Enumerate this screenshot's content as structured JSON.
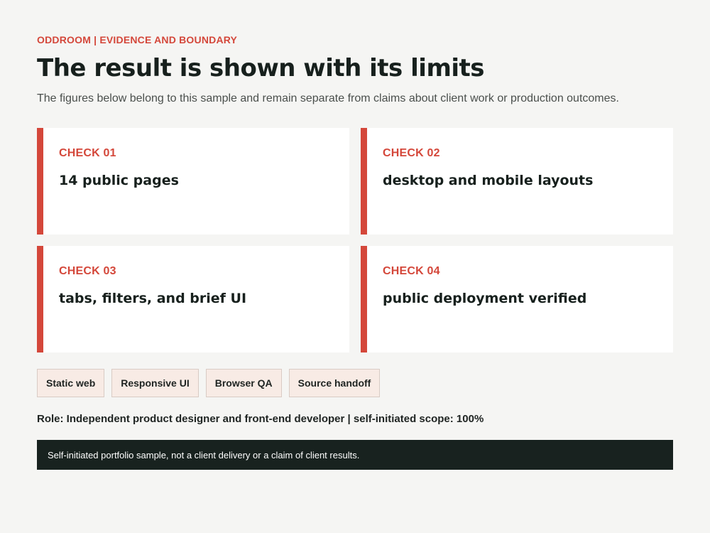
{
  "header": {
    "eyebrow": "ODDROOM | EVIDENCE AND BOUNDARY",
    "title": "The result is shown with its limits",
    "subtitle": "The figures below belong to this sample and remain separate from claims about client work or production outcomes."
  },
  "checks": [
    {
      "label": "CHECK 01",
      "text": "14 public pages"
    },
    {
      "label": "CHECK 02",
      "text": "desktop and mobile layouts"
    },
    {
      "label": "CHECK 03",
      "text": "tabs, filters, and brief UI"
    },
    {
      "label": "CHECK 04",
      "text": "public deployment verified"
    }
  ],
  "tags": [
    "Static web",
    "Responsive UI",
    "Browser QA",
    "Source handoff"
  ],
  "role": "Role: Independent product designer and front-end developer | self-initiated scope: 100%",
  "note": "Self-initiated portfolio sample, not a client delivery or a claim of client results.",
  "colors": {
    "accent": "#d4473a",
    "background": "#f5f5f3",
    "dark_panel": "#18221f",
    "tag_background": "#f8ebe5"
  }
}
